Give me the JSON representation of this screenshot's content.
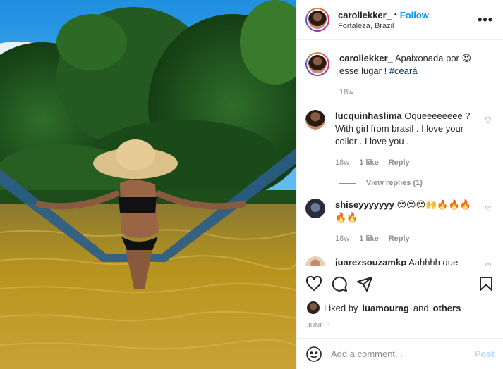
{
  "post": {
    "username": "carollekker_",
    "follow_label": "Follow",
    "separator": "•",
    "location": "Fortaleza, Brazil",
    "more_icon": "more-icon"
  },
  "caption": {
    "username": "carollekker_",
    "text": "Apaixonada por 😍 esse lugar !",
    "hashtag": "#ceará",
    "time": "18w"
  },
  "comments": [
    {
      "username": "lucquinhaslima",
      "text": "Oqueeeeeeee ? With girl from brasil . I love your collor . I love you .",
      "time": "18w",
      "likes": "1 like",
      "reply": "Reply",
      "view_replies": "View replies (1)"
    },
    {
      "username": "shiseyyyyyyy",
      "text": "😍😍😍🙌🔥🔥🔥🔥🔥",
      "time": "18w",
      "likes": "1 like",
      "reply": "Reply"
    },
    {
      "username": "juarezsouzamkp",
      "text": "Aahhhh que"
    }
  ],
  "likes": {
    "prefix": "Liked by",
    "user": "luamourag",
    "and": "and",
    "others": "others"
  },
  "date": "JUNE 3",
  "add_comment": {
    "placeholder": "Add a comment...",
    "post_label": "Post"
  },
  "colors": {
    "accent": "#0095f6",
    "hashtag": "#00376b",
    "muted": "#8e8e8e"
  }
}
